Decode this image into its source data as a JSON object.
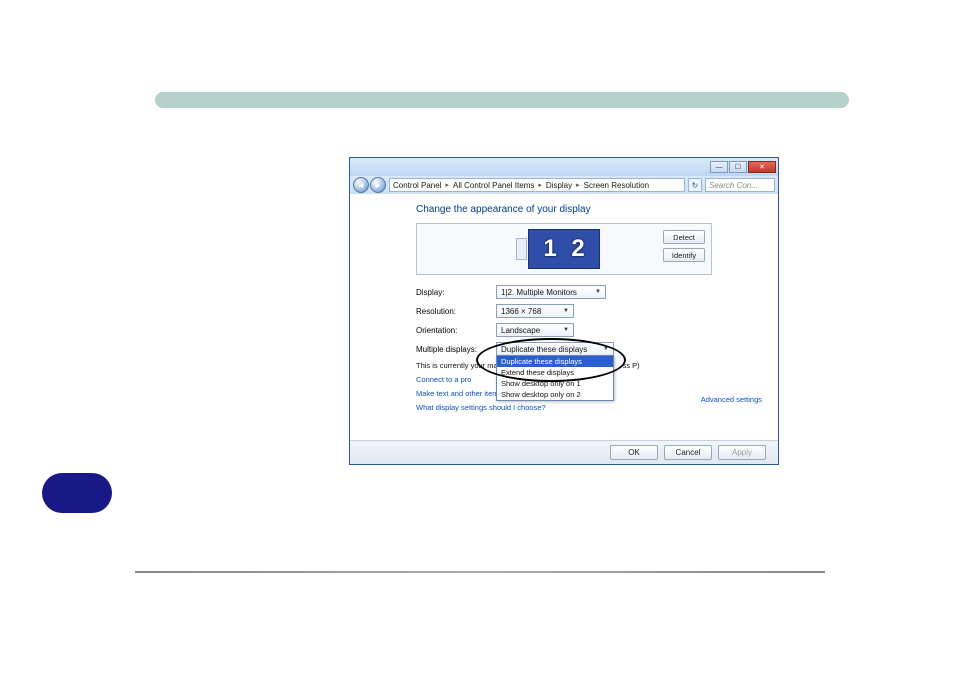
{
  "breadcrumbs": [
    "Control Panel",
    "All Control Panel Items",
    "Display",
    "Screen Resolution"
  ],
  "search_placeholder": "Search Con...",
  "heading": "Change the appearance of your display",
  "buttons": {
    "detect": "Detect",
    "identify": "Identify",
    "ok": "OK",
    "cancel": "Cancel",
    "apply": "Apply"
  },
  "labels": {
    "display": "Display:",
    "resolution": "Resolution:",
    "orientation": "Orientation:",
    "multiple": "Multiple displays:"
  },
  "values": {
    "display": "1|2. Multiple Monitors",
    "resolution": "1366 × 768",
    "orientation": "Landscape",
    "multiple": "Duplicate these displays"
  },
  "dropdown_options": [
    "Duplicate these displays",
    "Extend these displays",
    "Show desktop only on 1",
    "Show desktop only on 2"
  ],
  "notice_main": "This is currently your main display.",
  "notice_press_suffix": "ss P)",
  "links": {
    "projector": "Connect to a pro",
    "textsize": "Make text and other items larger or smaller",
    "whatsettings": "What display settings should I choose?",
    "advanced": "Advanced settings"
  },
  "monitor_numbers": [
    "1",
    "2"
  ]
}
